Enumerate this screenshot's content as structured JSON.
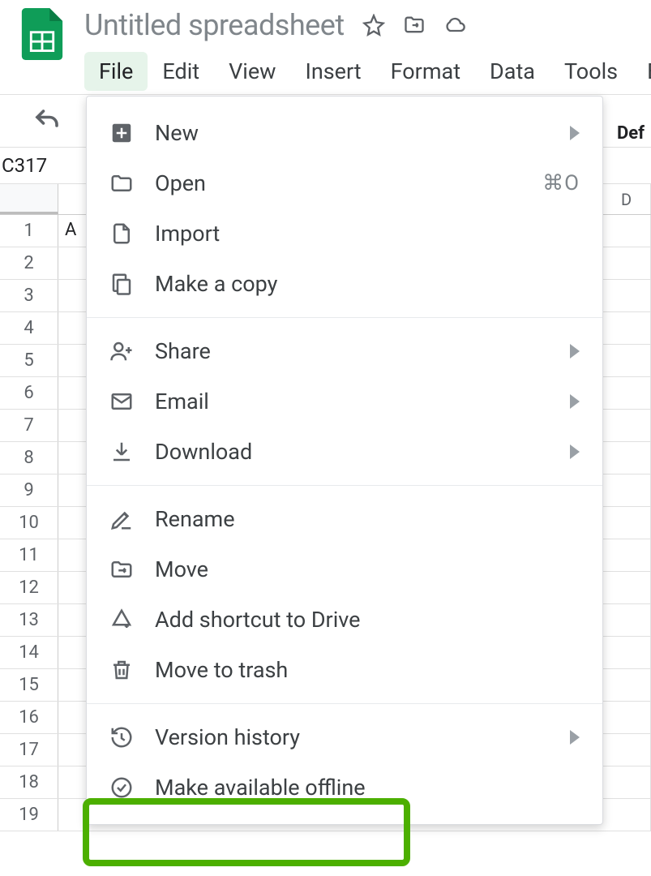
{
  "doc_title": "Untitled spreadsheet",
  "menubar": {
    "file": "File",
    "edit": "Edit",
    "view": "View",
    "insert": "Insert",
    "format": "Format",
    "data": "Data",
    "tools": "Tools",
    "ext": "Ext"
  },
  "toolbar": {
    "default_font_partial": "Def"
  },
  "namebox": "C317",
  "columns": {
    "d": "D"
  },
  "rows": [
    "1",
    "2",
    "3",
    "4",
    "5",
    "6",
    "7",
    "8",
    "9",
    "10",
    "11",
    "12",
    "13",
    "14",
    "15",
    "16",
    "17",
    "18",
    "19"
  ],
  "cell_a1": "A",
  "file_menu": {
    "new": "New",
    "open": "Open",
    "open_shortcut": "⌘O",
    "import": "Import",
    "make_copy": "Make a copy",
    "share": "Share",
    "email": "Email",
    "download": "Download",
    "rename": "Rename",
    "move": "Move",
    "add_shortcut": "Add shortcut to Drive",
    "trash": "Move to trash",
    "version_history": "Version history",
    "offline": "Make available offline"
  }
}
